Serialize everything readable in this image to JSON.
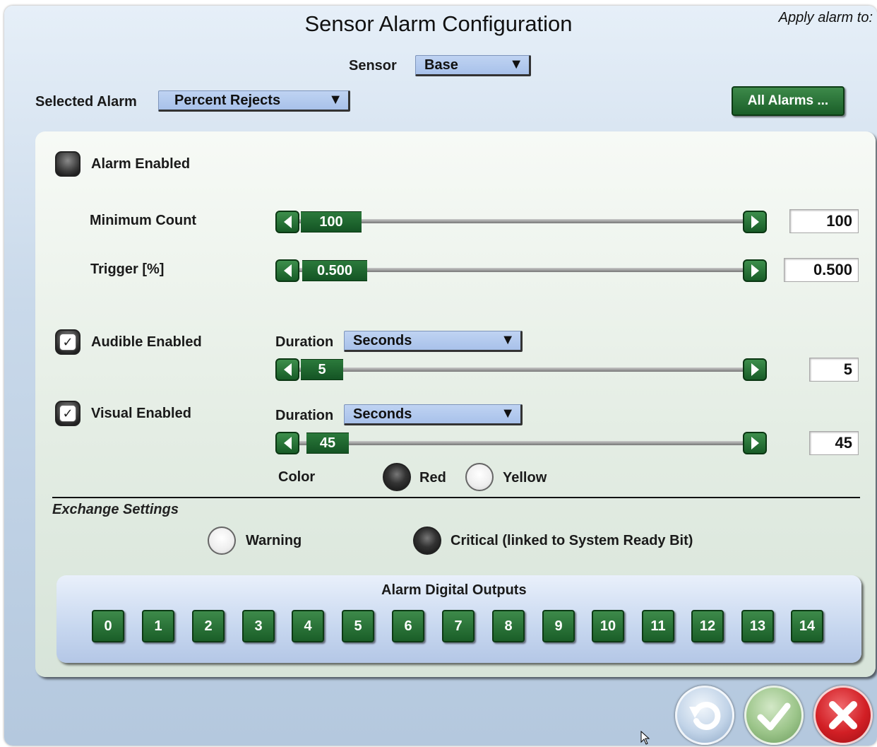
{
  "title": "Sensor Alarm Configuration",
  "apply_alarm_label": "Apply alarm to:",
  "sensor": {
    "label": "Sensor",
    "value": "Base"
  },
  "selected_alarm": {
    "label": "Selected Alarm",
    "value": "Percent Rejects"
  },
  "all_alarms_button": "All Alarms ...",
  "alarm_enabled": {
    "label": "Alarm Enabled",
    "checked": false
  },
  "minimum_count": {
    "label": "Minimum Count",
    "value": "100",
    "field": "100"
  },
  "trigger": {
    "label": "Trigger [%]",
    "value": "0.500",
    "field": "0.500"
  },
  "audible": {
    "label": "Audible Enabled",
    "checked": true,
    "duration_label": "Duration",
    "duration_unit": "Seconds",
    "value": "5",
    "field": "5"
  },
  "visual": {
    "label": "Visual Enabled",
    "checked": true,
    "duration_label": "Duration",
    "duration_unit": "Seconds",
    "value": "45",
    "field": "45",
    "color_label": "Color",
    "color_options": [
      {
        "label": "Red",
        "selected": true
      },
      {
        "label": "Yellow",
        "selected": false
      }
    ]
  },
  "exchange": {
    "title": "Exchange Settings",
    "options": [
      {
        "label": "Warning",
        "selected": false
      },
      {
        "label": "Critical (linked to System Ready Bit)",
        "selected": true
      }
    ]
  },
  "digital_outputs": {
    "title": "Alarm Digital Outputs",
    "items": [
      "0",
      "1",
      "2",
      "3",
      "4",
      "5",
      "6",
      "7",
      "8",
      "9",
      "10",
      "11",
      "12",
      "13",
      "14"
    ]
  },
  "icons": {
    "check_mark": "✓",
    "dropdown_arrow": "▼",
    "reset": "reset-icon",
    "ok": "check-icon",
    "cancel": "x-icon"
  },
  "colors": {
    "accent_green": "#1f6b2e",
    "dropdown_blue": "#aec5ec",
    "cancel_red": "#c8161b"
  }
}
